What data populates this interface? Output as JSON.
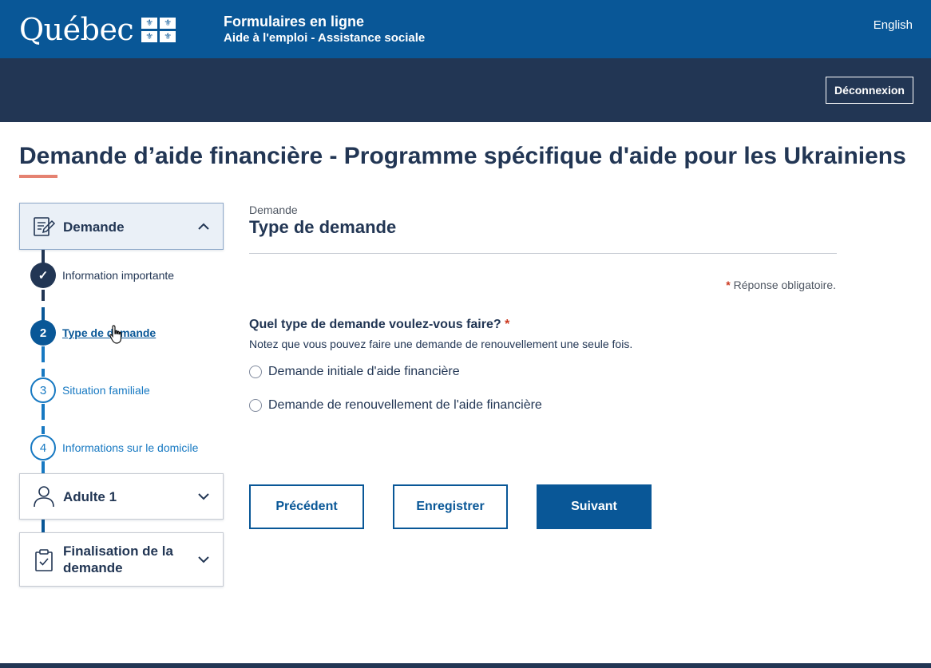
{
  "header": {
    "logo_text": "Québec",
    "app_title": "Formulaires en ligne",
    "app_subtitle": "Aide à l'emploi - Assistance sociale",
    "language_link": "English",
    "logout_label": "Déconnexion"
  },
  "page": {
    "title": "Demande d’aide financière - Programme spécifique d'aide pour les Ukrainiens"
  },
  "sidebar": {
    "sections": [
      {
        "label": "Demande",
        "icon": "form-edit-icon",
        "expanded": true
      },
      {
        "label": "Adulte 1",
        "icon": "person-icon",
        "expanded": false
      },
      {
        "label": "Finalisation de la demande",
        "icon": "clipboard-check-icon",
        "expanded": false
      }
    ],
    "steps": [
      {
        "number": "✓",
        "label": "Information importante",
        "state": "done"
      },
      {
        "number": "2",
        "label": "Type de demande",
        "state": "current"
      },
      {
        "number": "3",
        "label": "Situation familiale",
        "state": "todo"
      },
      {
        "number": "4",
        "label": "Informations sur le domicile",
        "state": "todo"
      }
    ]
  },
  "main": {
    "breadcrumb": "Demande",
    "section_heading": "Type de demande",
    "required_marker": "*",
    "required_note": "Réponse obligatoire.",
    "question": "Quel type de demande voulez-vous faire?",
    "question_hint": "Notez que vous pouvez faire une demande de renouvellement une seule fois.",
    "options": [
      {
        "label": "Demande initiale d'aide financière",
        "selected": false
      },
      {
        "label": "Demande de renouvellement de l'aide financière",
        "selected": false
      }
    ],
    "buttons": {
      "previous": "Précédent",
      "save": "Enregistrer",
      "next": "Suivant"
    }
  },
  "colors": {
    "primary_blue": "#095797",
    "dark_navy": "#223654",
    "accent_salmon": "#e58271",
    "required_red": "#cb381f",
    "link_blue": "#1779c2"
  }
}
